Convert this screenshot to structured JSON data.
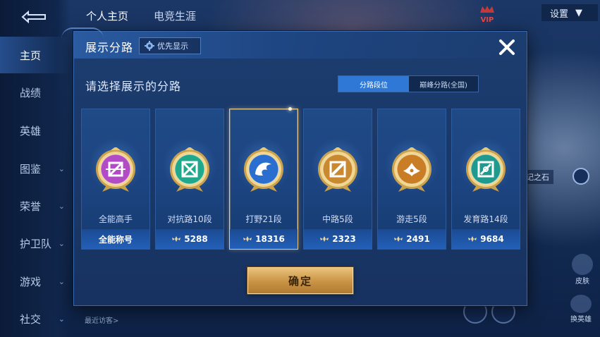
{
  "background": {
    "top_tabs": [
      "个人主页",
      "电竞生涯"
    ],
    "nav_items": [
      {
        "label": "主页",
        "active": true,
        "has_chevron": false
      },
      {
        "label": "战绩",
        "active": false,
        "has_chevron": false
      },
      {
        "label": "英雄",
        "active": false,
        "has_chevron": false
      },
      {
        "label": "图鉴",
        "active": false,
        "has_chevron": true
      },
      {
        "label": "荣誉",
        "active": false,
        "has_chevron": true
      },
      {
        "label": "护卫队",
        "active": false,
        "has_chevron": true
      },
      {
        "label": "游戏",
        "active": false,
        "has_chevron": true
      },
      {
        "label": "社交",
        "active": false,
        "has_chevron": true
      }
    ],
    "vip_label": "VIP",
    "settings_label": "设置",
    "stone_label": "记之石",
    "recent_visitors_label": "最近访客>",
    "side_btn_1": "皮肤",
    "side_btn_2": "换英雄"
  },
  "modal": {
    "title": "展示分路",
    "priority_label": "优先显示",
    "instruction": "请选择展示的分路",
    "toggle": {
      "options": [
        "分路段位",
        "巅峰分路(全国)"
      ],
      "active_index": 0
    },
    "cards": [
      {
        "name": "全能高手",
        "footer": "全能称号",
        "show_score_icon": false,
        "emblem": "allround",
        "emblem_color": "#b24bc6",
        "selected": false
      },
      {
        "name": "对抗路10段",
        "footer": "5288",
        "show_score_icon": true,
        "emblem": "clash",
        "emblem_color": "#1fa88c",
        "selected": false
      },
      {
        "name": "打野21段",
        "footer": "18316",
        "show_score_icon": true,
        "emblem": "jungle",
        "emblem_color": "#2a6fd0",
        "selected": true
      },
      {
        "name": "中路5段",
        "footer": "2323",
        "show_score_icon": true,
        "emblem": "mid",
        "emblem_color": "#c9892e",
        "selected": false
      },
      {
        "name": "游走5段",
        "footer": "2491",
        "show_score_icon": true,
        "emblem": "roam",
        "emblem_color": "#c97e25",
        "selected": false
      },
      {
        "name": "发育路14段",
        "footer": "9684",
        "show_score_icon": true,
        "emblem": "farm",
        "emblem_color": "#1f9a8e",
        "selected": false
      }
    ],
    "confirm_label": "确定"
  },
  "colors": {
    "accent_blue": "#2f78d6",
    "gold": "#e6c88a",
    "modal_bg": "#1c3d70"
  }
}
